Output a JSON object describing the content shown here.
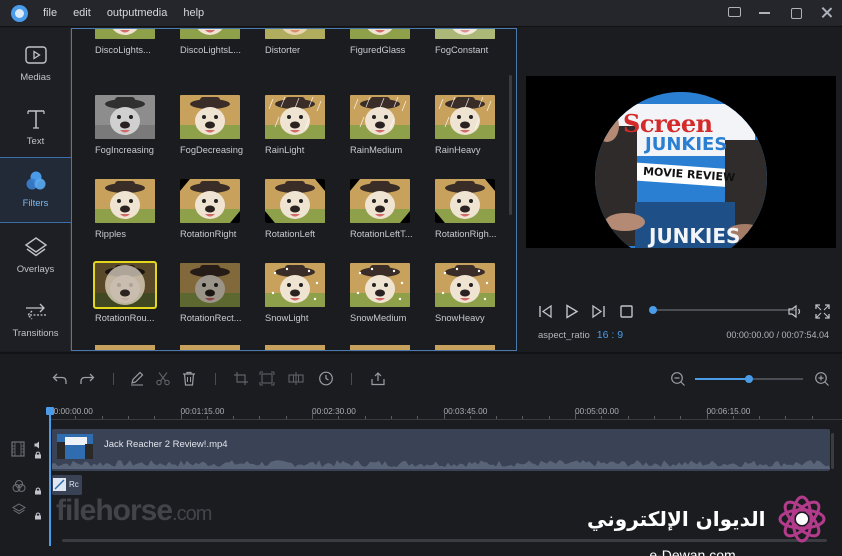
{
  "menu": {
    "items": [
      "file",
      "edit",
      "outputmedia",
      "help"
    ]
  },
  "window_controls": {
    "icons": [
      "message-icon",
      "minimize-icon",
      "maximize-icon",
      "close-icon"
    ]
  },
  "sidebar": {
    "items": [
      {
        "label": "Medias",
        "icon": "media-icon",
        "active": false
      },
      {
        "label": "Text",
        "icon": "text-icon",
        "active": false
      },
      {
        "label": "Filters",
        "icon": "filters-icon",
        "active": true
      },
      {
        "label": "Overlays",
        "icon": "overlays-icon",
        "active": false
      },
      {
        "label": "Transitions",
        "icon": "transitions-icon",
        "active": false
      }
    ]
  },
  "filters": {
    "rows": [
      [
        "DiscoLights...",
        "DiscoLightsL...",
        "Distorter",
        "FiguredGlass",
        "FogConstant"
      ],
      [
        "FogIncreasing",
        "FogDecreasing",
        "RainLight",
        "RainMedium",
        "RainHeavy"
      ],
      [
        "Ripples",
        "RotationRight",
        "RotationLeft",
        "RotationLeftT...",
        "RotationRigh..."
      ],
      [
        "RotationRou...",
        "RotationRect...",
        "SnowLight",
        "SnowMedium",
        "SnowHeavy"
      ]
    ],
    "selected": "RotationRou..."
  },
  "preview": {
    "sign_line1": "Screen",
    "sign_line2": "JUNKIES",
    "sign_line3": "MOVIE REVIEW",
    "sign_line4": "JUNKIES"
  },
  "player": {
    "aspect_label": "aspect_ratio",
    "aspect_value": "16 : 9",
    "timecode": "00:00:00.00 / 00:07:54.04",
    "progress": 0.0
  },
  "toolbar": {
    "zoom_level": 0.5
  },
  "timeline": {
    "ticks": [
      "00:00:00.00",
      "00:01:15.00",
      "00:02:30.00",
      "00:03:45.00",
      "00:05:00.00",
      "00:06:15.00"
    ],
    "video_clip": "Jack Reacher 2 Review!.mp4",
    "overlay_clip": "Rc"
  },
  "watermarks": {
    "filehorse": "filehorse",
    "filehorse_suffix": ".com",
    "dewan_ar": "الديوان الإلكتروني",
    "dewan_url": "e-Dewan.com"
  },
  "colors": {
    "accent": "#4a9be8",
    "selection": "#e3d71b",
    "track": "#3a4356"
  }
}
